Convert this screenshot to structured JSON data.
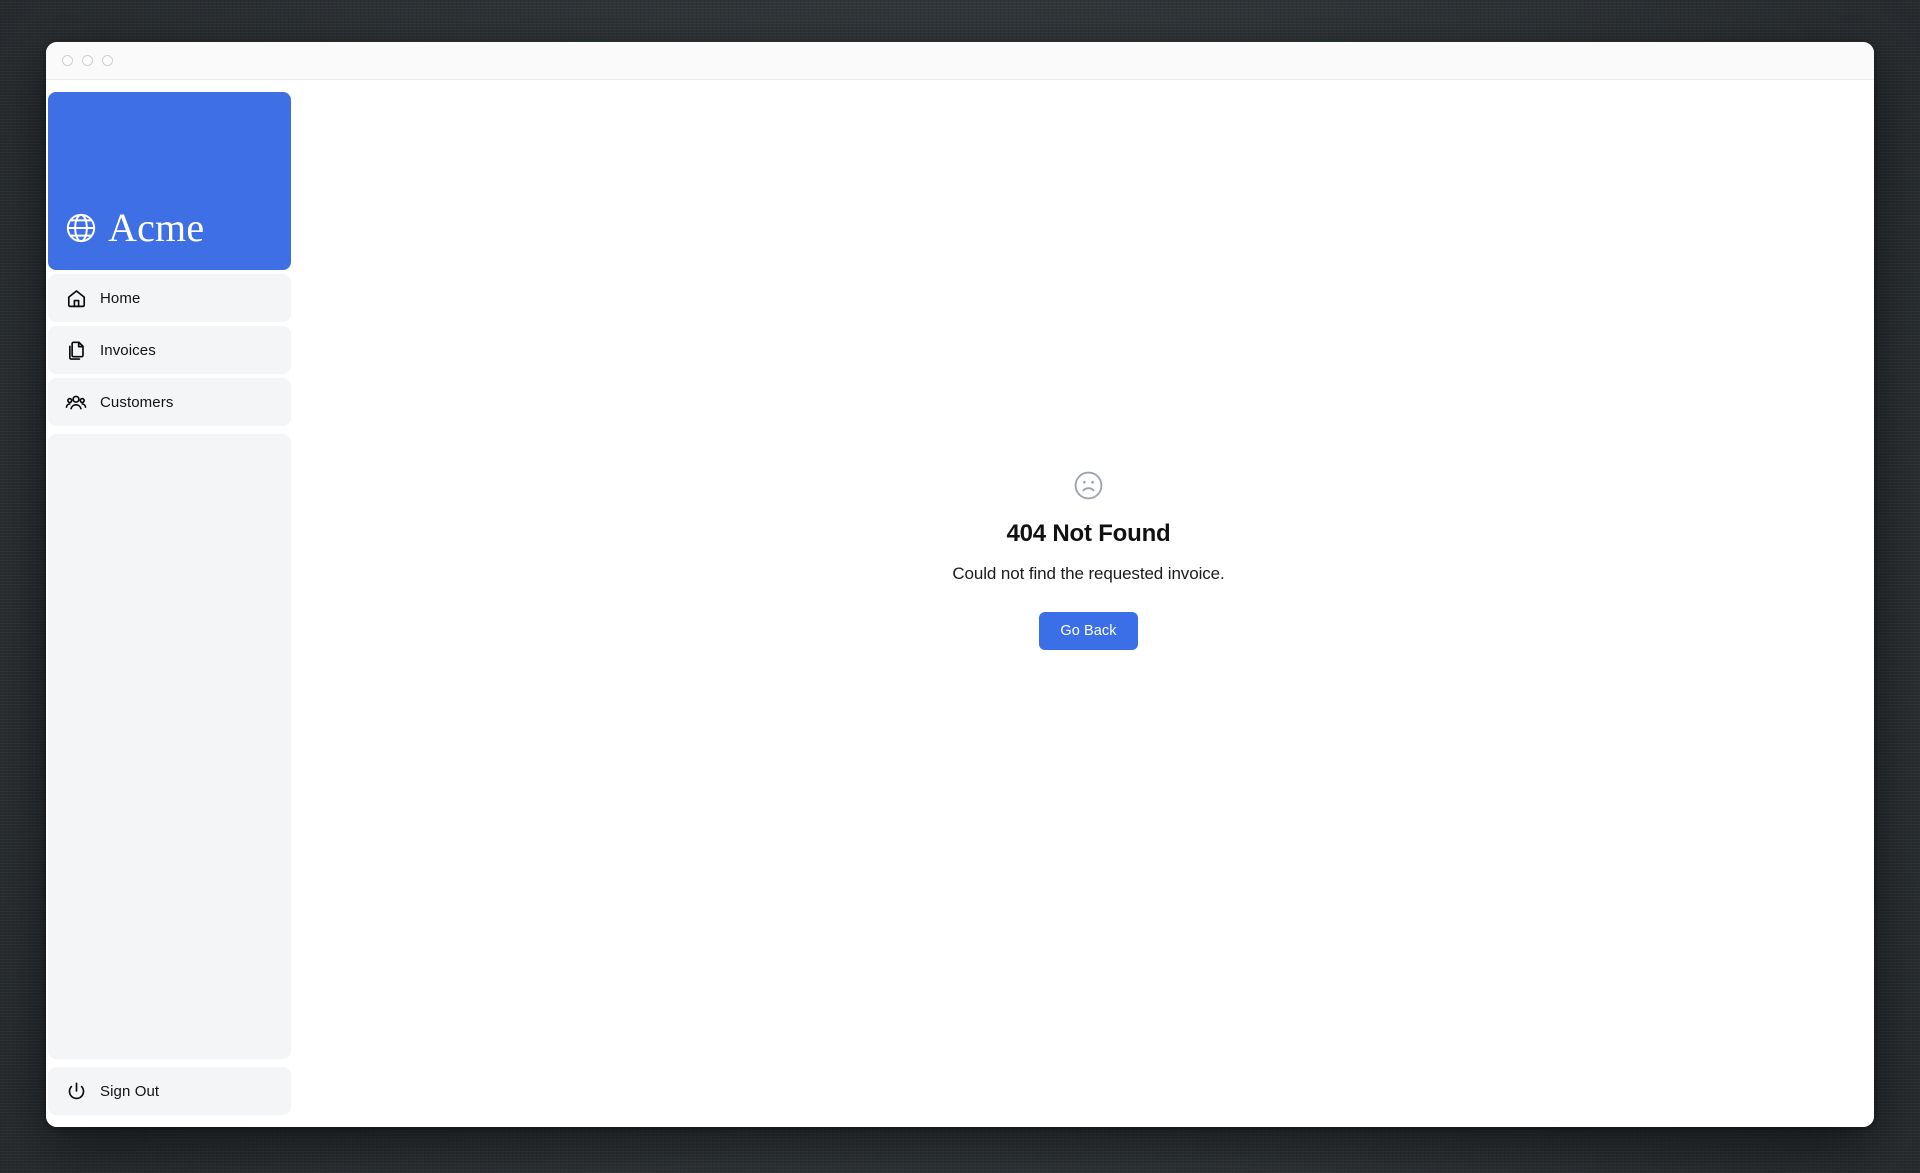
{
  "window": {
    "traffic_lights": [
      "close",
      "minimize",
      "maximize"
    ]
  },
  "sidebar": {
    "brand": {
      "label": "Acme",
      "icon": "globe-icon",
      "background_color": "#3f6fe4"
    },
    "items": [
      {
        "label": "Home",
        "icon": "home-icon"
      },
      {
        "label": "Invoices",
        "icon": "documents-icon"
      },
      {
        "label": "Customers",
        "icon": "users-icon"
      }
    ],
    "sign_out": {
      "label": "Sign Out",
      "icon": "power-icon"
    }
  },
  "main": {
    "error": {
      "icon": "face-frown-icon",
      "title": "404 Not Found",
      "message": "Could not find the requested invoice.",
      "action_label": "Go Back",
      "action_color": "#3b6fe8"
    }
  }
}
